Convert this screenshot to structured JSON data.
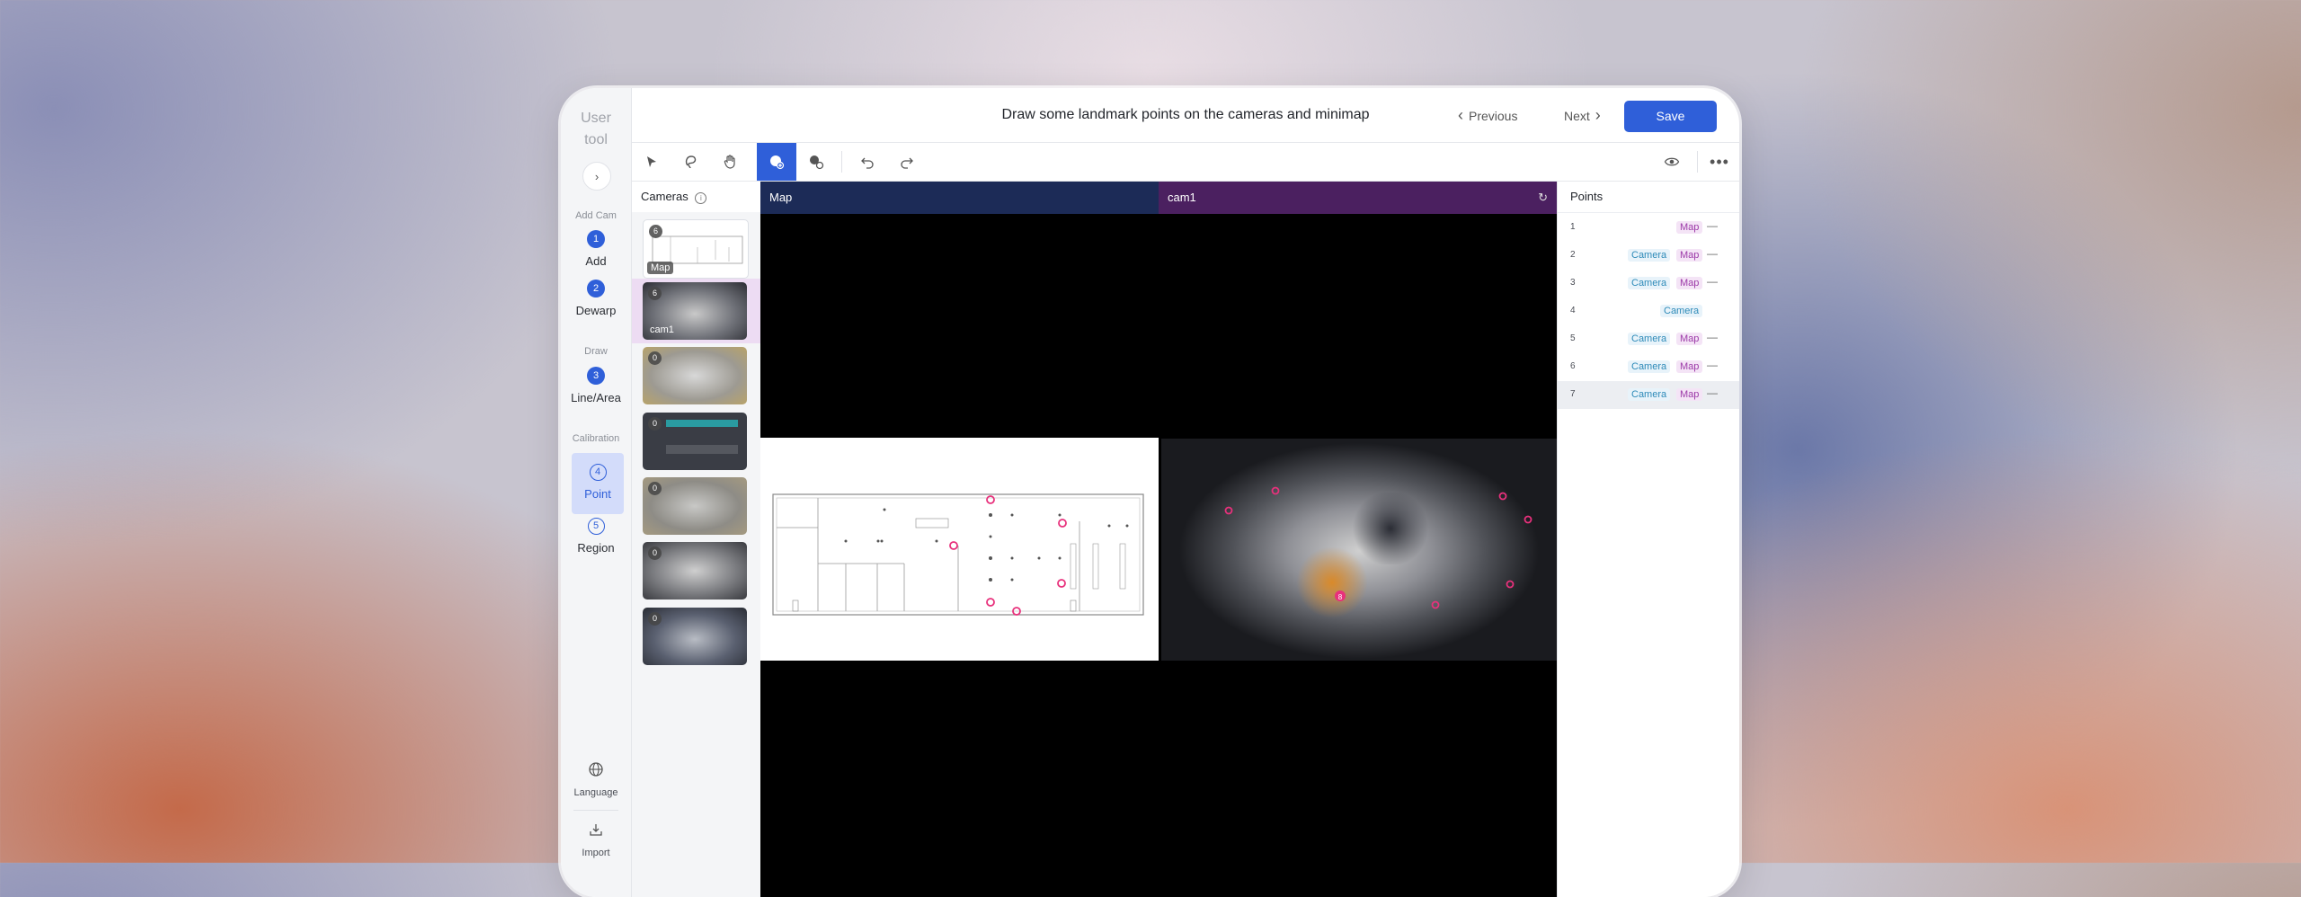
{
  "brand": {
    "line1": "User",
    "line2": "tool"
  },
  "rail": {
    "groups": {
      "add_cam": "Add Cam",
      "draw": "Draw",
      "calibration": "Calibration"
    },
    "steps": [
      {
        "num": "1",
        "label": "Add"
      },
      {
        "num": "2",
        "label": "Dewarp"
      },
      {
        "num": "3",
        "label": "Line/Area"
      },
      {
        "num": "4",
        "label": "Point",
        "active": true
      },
      {
        "num": "5",
        "label": "Region"
      }
    ],
    "bottom": {
      "language": "Language",
      "import": "Import"
    }
  },
  "header": {
    "title": "Draw some landmark points on the cameras and minimap",
    "previous": "Previous",
    "next": "Next",
    "save": "Save"
  },
  "toolbar": {
    "tools": [
      "pointer-icon",
      "lasso-icon",
      "hand-icon",
      "add-point-icon",
      "points-icon",
      "undo-icon",
      "redo-icon"
    ],
    "active_tool": "add-point-icon"
  },
  "cameras": {
    "title": "Cameras",
    "items": [
      {
        "count": "6",
        "label": "Map"
      },
      {
        "count": "6",
        "label": "cam1",
        "selected": true
      },
      {
        "count": "0"
      },
      {
        "count": "0"
      },
      {
        "count": "0"
      },
      {
        "count": "0"
      },
      {
        "count": "0"
      }
    ]
  },
  "views": {
    "map": {
      "title": "Map",
      "header_color": "#1c2b57"
    },
    "cam": {
      "title": "cam1",
      "header_color": "#4b2060"
    }
  },
  "points": {
    "title": "Points",
    "rows": [
      {
        "id": "1",
        "camera": "",
        "map": "Map"
      },
      {
        "id": "2",
        "camera": "Camera",
        "map": "Map"
      },
      {
        "id": "3",
        "camera": "Camera",
        "map": "Map"
      },
      {
        "id": "4",
        "camera": "Camera",
        "map": ""
      },
      {
        "id": "5",
        "camera": "Camera",
        "map": "Map"
      },
      {
        "id": "6",
        "camera": "Camera",
        "map": "Map"
      },
      {
        "id": "7",
        "camera": "Camera",
        "map": "Map",
        "selected": true
      }
    ]
  },
  "colors": {
    "accent": "#2f5fd9",
    "marker": "#e8317c"
  }
}
